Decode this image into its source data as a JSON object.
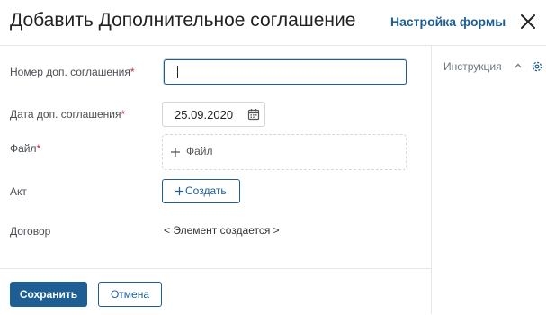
{
  "header": {
    "title": "Добавить Дополнительное соглашение",
    "settings_link": "Настройка формы"
  },
  "form": {
    "number": {
      "label": "Номер доп. соглашения",
      "required_mark": "*",
      "value": ""
    },
    "date": {
      "label": "Дата доп. соглашения",
      "required_mark": "*",
      "value": "25.09.2020"
    },
    "file": {
      "label": "Файл",
      "required_mark": "*",
      "button_label": "Файл"
    },
    "act": {
      "label": "Акт",
      "button_label": "Создать"
    },
    "contract": {
      "label": "Договор",
      "value": "< Элемент создается >"
    }
  },
  "side_panel": {
    "instructions_label": "Инструкция"
  },
  "footer": {
    "save_label": "Сохранить",
    "cancel_label": "Отмена"
  },
  "colors": {
    "accent": "#1d5f95",
    "required": "#c0283e",
    "border": "#e4e7ea"
  }
}
